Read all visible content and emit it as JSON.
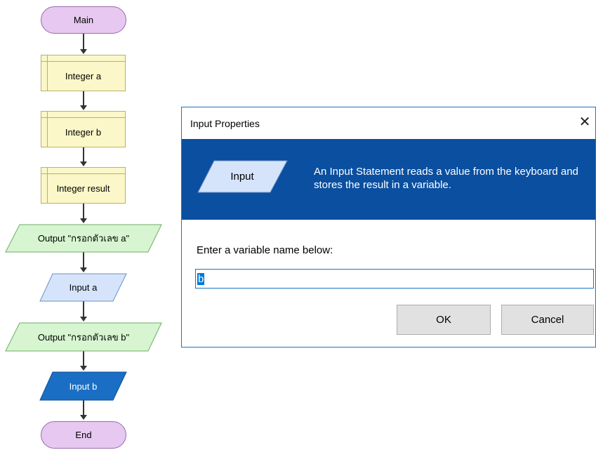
{
  "flowchart": {
    "main": "Main",
    "declare_a": "Integer a",
    "declare_b": "Integer b",
    "declare_result": "Integer result",
    "output_a": "Output \"กรอกตัวเลข a\"",
    "input_a": "Input a",
    "output_b": "Output \"กรอกตัวเลข b\"",
    "input_b": "Input b",
    "end": "End"
  },
  "dialog": {
    "title": "Input Properties",
    "close_icon": "close-icon",
    "banner_shape_label": "Input",
    "banner_text": "An Input Statement reads a value from the keyboard and stores the result in a variable.",
    "prompt": "Enter a variable name below:",
    "variable_value": "b",
    "ok_label": "OK",
    "cancel_label": "Cancel"
  },
  "colors": {
    "terminal_fill": "#e6c8f0",
    "declare_fill": "#fbf7c8",
    "output_fill": "#d6f5d0",
    "input_fill": "#d6e4fb",
    "selected_fill": "#1a6fc4",
    "banner_fill": "#0a4fa0"
  }
}
